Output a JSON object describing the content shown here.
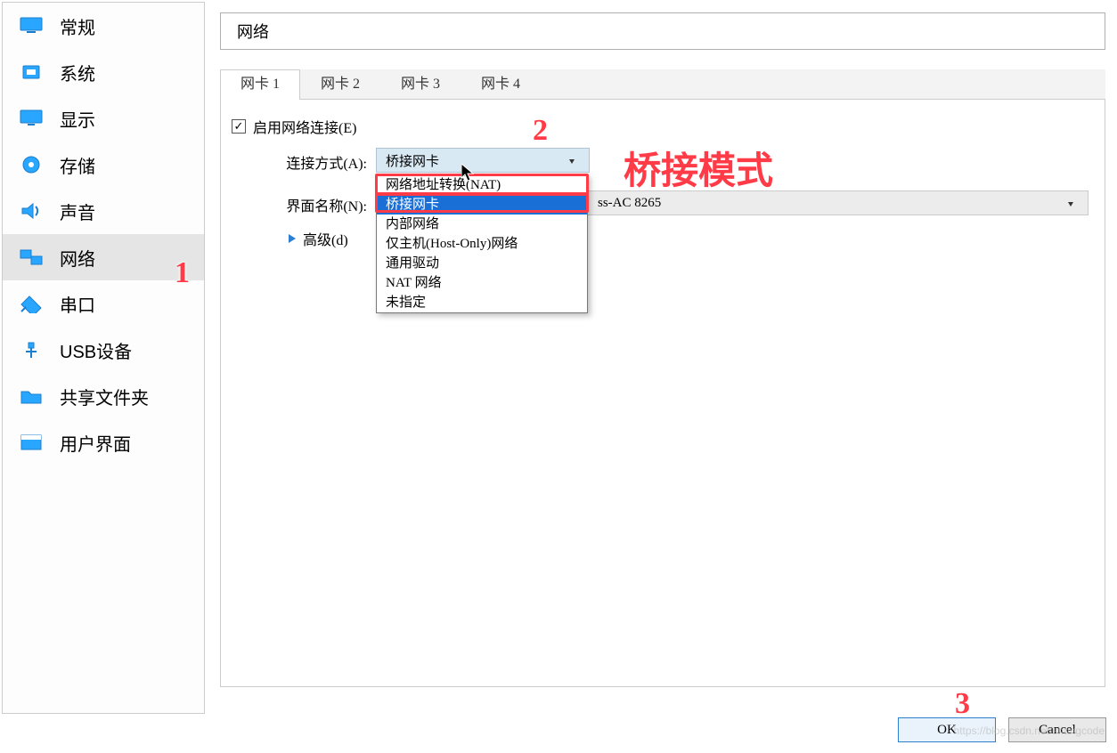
{
  "sidebar": {
    "items": [
      {
        "label": "常规",
        "icon": "monitor",
        "active": false
      },
      {
        "label": "系统",
        "icon": "chip",
        "active": false
      },
      {
        "label": "显示",
        "icon": "display",
        "active": false
      },
      {
        "label": "存储",
        "icon": "disk",
        "active": false
      },
      {
        "label": "声音",
        "icon": "speaker",
        "active": false
      },
      {
        "label": "网络",
        "icon": "network",
        "active": true
      },
      {
        "label": "串口",
        "icon": "serial",
        "active": false
      },
      {
        "label": "USB设备",
        "icon": "usb",
        "active": false
      },
      {
        "label": "共享文件夹",
        "icon": "folder",
        "active": false
      },
      {
        "label": "用户界面",
        "icon": "ui",
        "active": false
      }
    ]
  },
  "page_title": "网络",
  "tabs": [
    {
      "label": "网卡 1",
      "active": true
    },
    {
      "label": "网卡 2",
      "active": false
    },
    {
      "label": "网卡 3",
      "active": false
    },
    {
      "label": "网卡 4",
      "active": false
    }
  ],
  "enable_network_label": "启用网络连接(E)",
  "enable_network_checked": true,
  "attach_label": "连接方式(A):",
  "attach_selected": "桥接网卡",
  "iface_label": "界面名称(N):",
  "iface_value_visible_suffix": "ss-AC 8265",
  "advanced_label": "高级(d)",
  "dropdown_options": [
    "网络地址转换(NAT)",
    "桥接网卡",
    "内部网络",
    "仅主机(Host-Only)网络",
    "通用驱动",
    "NAT 网络",
    "未指定"
  ],
  "dropdown_highlight_index": 1,
  "buttons": {
    "ok": "OK",
    "cancel": "Cancel"
  },
  "annotations": {
    "n1": "1",
    "n2": "2",
    "n3": "3",
    "note": "桥接模式"
  },
  "watermark": "https://blog.csdn.net/shangcode"
}
